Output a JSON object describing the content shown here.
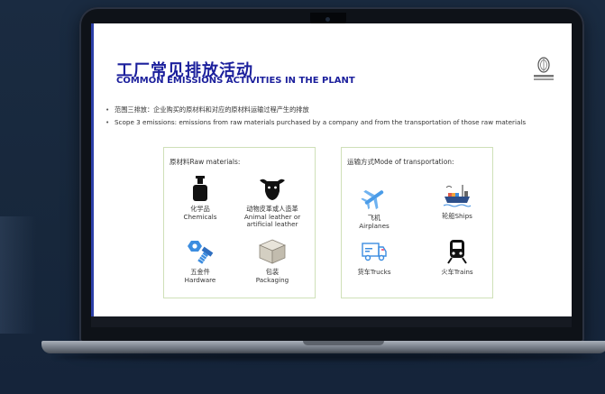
{
  "slide": {
    "title_cn": "工厂常见排放活动",
    "title_en": "COMMON EMISSIONS ACTIVITIES IN THE PLANT",
    "bullets": [
      "范围三排放：企业购买的原材料和对应的原材料运输过程产生的排放",
      "Scope 3 emissions: emissions from raw materials purchased by a company and from the transportation of those raw materials"
    ],
    "raw_materials": {
      "title": "原材料Raw materials:",
      "items": [
        {
          "icon": "chemical-bottle-icon",
          "cn": "化学品",
          "en": [
            "Chemicals"
          ]
        },
        {
          "icon": "cow-head-icon",
          "cn": "动物皮革或人造革",
          "en": [
            "Animal leather or",
            "artificial leather"
          ]
        },
        {
          "icon": "bolt-nut-icon",
          "cn": "五金件",
          "en": [
            "Hardware"
          ]
        },
        {
          "icon": "package-box-icon",
          "cn": "包装",
          "en": [
            "Packaging"
          ]
        }
      ]
    },
    "transportation": {
      "title": "运输方式Mode of transportation:",
      "items": [
        {
          "icon": "airplane-icon",
          "cn": "飞机",
          "en": "Airplanes"
        },
        {
          "icon": "ship-icon",
          "label": "轮船Ships"
        },
        {
          "icon": "truck-icon",
          "label": "货车Trucks"
        },
        {
          "icon": "train-icon",
          "label": "火车Trains"
        }
      ]
    }
  },
  "colors": {
    "title": "#1b1f9c",
    "panel_border": "#cfe0b8",
    "accent_blue": "#3c8de0",
    "background": "#18283d"
  }
}
